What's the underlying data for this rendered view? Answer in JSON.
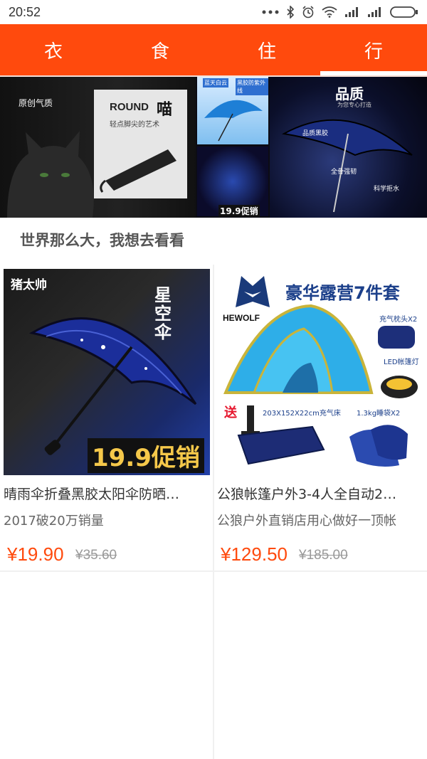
{
  "status_bar": {
    "time": "20:52"
  },
  "nav": {
    "tabs": [
      {
        "label": "衣",
        "active": false
      },
      {
        "label": "食",
        "active": false
      },
      {
        "label": "住",
        "active": false
      },
      {
        "label": "行",
        "active": true
      }
    ]
  },
  "banner": {
    "text_left": "原创气质",
    "text_round": "ROUND",
    "text_cat": "喵",
    "text_tagline": "轻点脚尖的艺术",
    "text_quality": "品质",
    "text_quality_sub": "为您专心打造",
    "text_price_tag": "19.9促销",
    "text_labels": [
      "品质黑胶",
      "全骨强韧",
      "科学拒水"
    ],
    "text_top_tags": [
      "蓝天白云",
      "黑胶防紫外线"
    ]
  },
  "section": {
    "title": "世界那么大，我想去看看"
  },
  "products": [
    {
      "title": "晴雨伞折叠黑胶太阳伞防晒…",
      "subtitle": "2017破20万销量",
      "price": "¥19.90",
      "original_price": "¥35.60",
      "image": {
        "brand": "猪太帅",
        "badge": "星空伞",
        "promo": "19.9促销"
      }
    },
    {
      "title": "公狼帐篷户外3-4人全自动2…",
      "subtitle": "公狼户外直销店用心做好一顶帐",
      "price": "¥129.50",
      "original_price": "¥185.00",
      "image": {
        "brand": "HEWOLF",
        "headline": "豪华露营7件套",
        "label_pillow": "充气枕头X2",
        "label_lamp": "LED帐篷灯",
        "label_send": "送",
        "label_bed": "203X152X22cm充气床",
        "label_bag": "1.3kg睡袋X2"
      }
    }
  ],
  "colors": {
    "accent": "#ff4a0d",
    "price": "#ff4a0d"
  }
}
